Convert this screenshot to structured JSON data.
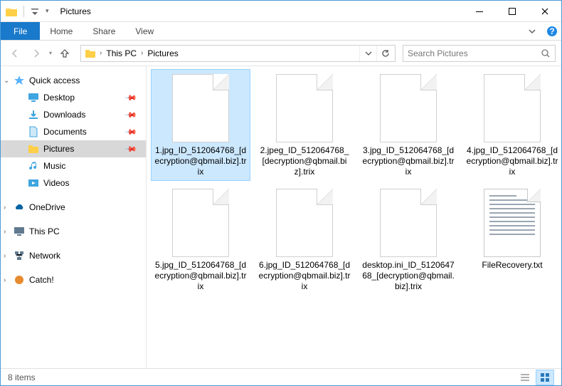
{
  "titlebar": {
    "title": "Pictures"
  },
  "ribbon": {
    "file": "File",
    "tabs": [
      "Home",
      "Share",
      "View"
    ]
  },
  "breadcrumb": {
    "items": [
      "This PC",
      "Pictures"
    ]
  },
  "search": {
    "placeholder": "Search Pictures"
  },
  "navpane": {
    "quick_access": "Quick access",
    "quick_children": [
      "Desktop",
      "Downloads",
      "Documents",
      "Pictures",
      "Music",
      "Videos"
    ],
    "onedrive": "OneDrive",
    "this_pc": "This PC",
    "network": "Network",
    "catch": "Catch!"
  },
  "files": [
    {
      "name": "1.jpg_ID_512064768_[decryption@qbmail.biz].trix",
      "type": "blank",
      "selected": true
    },
    {
      "name": "2.jpeg_ID_512064768_[decryption@qbmail.biz].trix",
      "type": "blank"
    },
    {
      "name": "3.jpg_ID_512064768_[decryption@qbmail.biz].trix",
      "type": "blank"
    },
    {
      "name": "4.jpg_ID_512064768_[decryption@qbmail.biz].trix",
      "type": "blank"
    },
    {
      "name": "5.jpg_ID_512064768_[decryption@qbmail.biz].trix",
      "type": "blank"
    },
    {
      "name": "6.jpg_ID_512064768_[decryption@qbmail.biz].trix",
      "type": "blank"
    },
    {
      "name": "desktop.ini_ID_512064768_[decryption@qbmail.biz].trix",
      "type": "blank"
    },
    {
      "name": "FileRecovery.txt",
      "type": "txt"
    }
  ],
  "status": {
    "count": "8 items"
  }
}
